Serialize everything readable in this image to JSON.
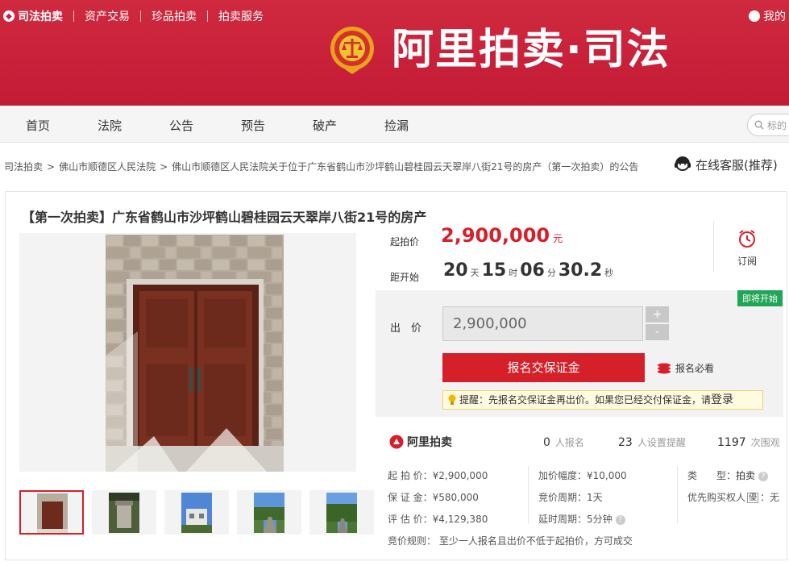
{
  "topnav": {
    "items": [
      "司法拍卖",
      "资产交易",
      "珍品拍卖",
      "拍卖服务"
    ],
    "right_text": "我的"
  },
  "brand": {
    "name": "阿里拍卖·司法"
  },
  "mainnav": {
    "items": [
      "首页",
      "法院",
      "公告",
      "预告",
      "破产",
      "捡漏"
    ],
    "search_placeholder": "标的"
  },
  "breadcrumb": [
    "司法拍卖",
    "佛山市顺德区人民法院",
    "佛山市顺德区人民法院关于位于广东省鹤山市沙坪鹤山碧桂园云天翠岸八街21号的房产（第一次拍卖）的公告"
  ],
  "service": {
    "label": "在线客服(推荐)"
  },
  "listing": {
    "title": "【第一次拍卖】广东省鹤山市沙坪鹤山碧桂园云天翠岸八街21号的房产",
    "start_price_label": "起拍价",
    "start_price": "2,900,000",
    "currency": "元",
    "countdown_label": "距开始",
    "countdown": {
      "days": "20",
      "days_unit": "天",
      "hours": "15",
      "hours_unit": "时",
      "minutes": "06",
      "minutes_unit": "分",
      "seconds": "30.2",
      "seconds_unit": "秒"
    },
    "subscribe_label": "订阅",
    "status_badge": "即将开始",
    "bid_label": "出　价",
    "bid_value": "2,900,000",
    "stepper_plus": "+",
    "stepper_minus": "-",
    "signup_button": "报名交保证金",
    "must_read": "报名必看",
    "tip_text": "提醒：先报名交保证金再出价。如果您已经交付保证金，请",
    "tip_login": "登录"
  },
  "stats": {
    "logo": "阿里拍卖",
    "signups": {
      "value": "0",
      "label": "人报名"
    },
    "reminders": {
      "value": "23",
      "label": "人设置提醒"
    },
    "views": {
      "value": "1197",
      "label": "次围观"
    }
  },
  "info": {
    "start_price": "起 拍 价：¥2,900,000",
    "deposit": "保 证 金：¥580,000",
    "valuation": "评 估 价：¥4,129,380",
    "increment": "加价幅度：¥10,000",
    "bid_cycle": "竞价周期：1天",
    "delay_cycle": "延时周期：5分钟",
    "type_label": "类　　型：",
    "type_value": "拍卖",
    "priority_label": "优先购买权人",
    "priority_tag": "優",
    "priority_value": "：无",
    "rule": "竞价规则：  至少一人报名且出价不低于起拍价，方可成交"
  },
  "help_icon_glyph": "?"
}
